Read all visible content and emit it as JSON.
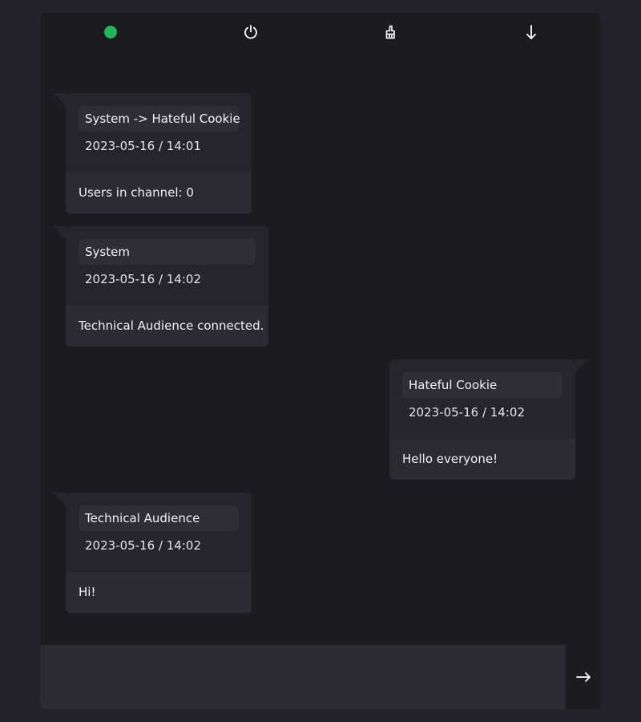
{
  "theme": {
    "status_color": "#22b55a",
    "icon_color": "#ffffff"
  },
  "toolbar": {
    "status": "online",
    "icons": [
      "status-dot",
      "power-icon",
      "hand-icon",
      "arrow-down-icon"
    ]
  },
  "messages": [
    {
      "side": "left",
      "author": "System -> Hateful Cookie",
      "time": "2023-05-16 / 14:01",
      "text": "Users in channel: 0"
    },
    {
      "side": "left",
      "author": "System",
      "time": "2023-05-16 / 14:02",
      "text": "Technical Audience connected."
    },
    {
      "side": "right",
      "author": "Hateful Cookie",
      "time": "2023-05-16 / 14:02",
      "text": "Hello everyone!"
    },
    {
      "side": "left",
      "author": "Technical Audience",
      "time": "2023-05-16 / 14:02",
      "text": "Hi!"
    }
  ],
  "composer": {
    "value": "",
    "placeholder": "",
    "send_icon": "arrow-right-icon"
  }
}
